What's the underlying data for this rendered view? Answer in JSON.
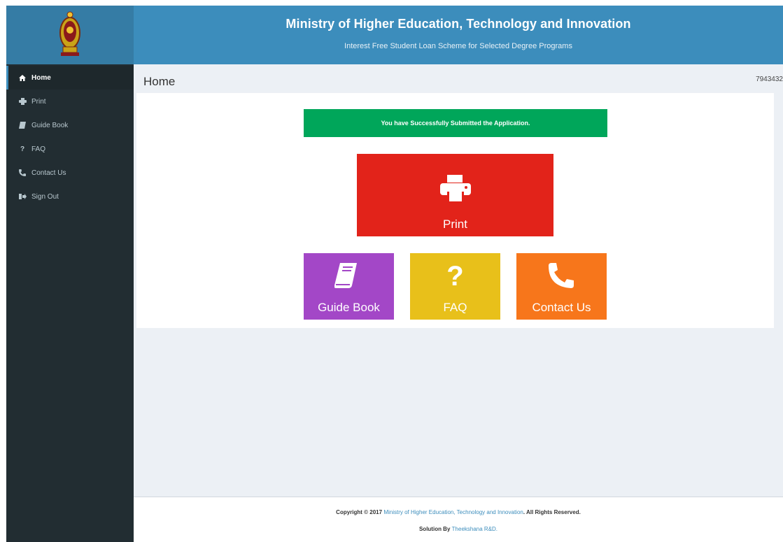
{
  "header": {
    "title": "Ministry of Higher Education, Technology and Innovation",
    "subtitle": "Interest Free Student Loan Scheme for Selected Degree Programs"
  },
  "sidebar": {
    "items": [
      {
        "label": "Home",
        "icon": "home-icon",
        "active": true
      },
      {
        "label": "Print",
        "icon": "print-icon"
      },
      {
        "label": "Guide Book",
        "icon": "book-icon"
      },
      {
        "label": "FAQ",
        "icon": "question-icon"
      },
      {
        "label": "Contact Us",
        "icon": "phone-icon"
      },
      {
        "label": "Sign Out",
        "icon": "sign-out-icon"
      }
    ]
  },
  "content": {
    "page_title": "Home",
    "user_id": "7943432",
    "alert": "You have Successfully Submitted the Application.",
    "tiles": {
      "print": {
        "label": "Print",
        "icon": "print-icon",
        "color": "#e2231a"
      },
      "guide": {
        "label": "Guide Book",
        "icon": "book-icon",
        "color": "#a347c7"
      },
      "faq": {
        "label": "FAQ",
        "icon": "question-icon",
        "color": "#e8c01a"
      },
      "contact": {
        "label": "Contact Us",
        "icon": "phone-icon",
        "color": "#f7761b"
      }
    }
  },
  "footer": {
    "copyright_prefix": "Copyright © 2017",
    "ministry_link": "Ministry of Higher Education, Technology and Innovation",
    "rights": ". All Rights Reserved.",
    "solution_prefix": "Solution By",
    "solution_link": "Theekshana R&D."
  },
  "colors": {
    "header_bg": "#3c8dbc",
    "sidebar_bg": "#222d32",
    "alert_green": "#00a65a"
  }
}
